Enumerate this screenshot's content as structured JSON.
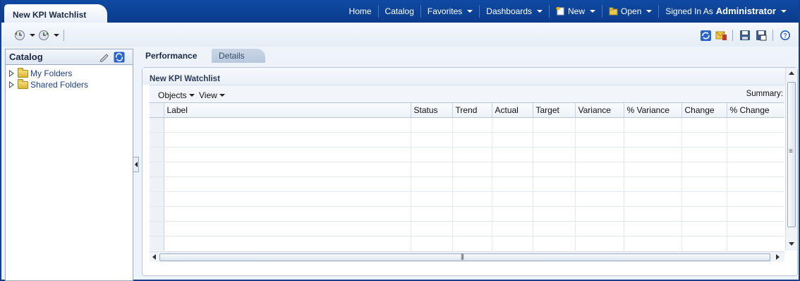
{
  "page_tab": {
    "title": "New KPI Watchlist"
  },
  "global_nav": {
    "home": "Home",
    "catalog": "Catalog",
    "favorites": "Favorites",
    "dashboards": "Dashboards",
    "new": "New",
    "open": "Open",
    "signed_in_as": "Signed In As",
    "user": "Administrator"
  },
  "catalog": {
    "title": "Catalog",
    "items": [
      {
        "label": "My Folders"
      },
      {
        "label": "Shared Folders"
      }
    ]
  },
  "tabs": [
    {
      "label": "Performance",
      "active": true
    },
    {
      "label": "Details",
      "active": false
    }
  ],
  "watchlist": {
    "title": "New KPI Watchlist",
    "menus": {
      "objects": "Objects",
      "view": "View"
    },
    "summary_label": "Summary:",
    "columns": [
      "Label",
      "Status",
      "Trend",
      "Actual",
      "Target",
      "Variance",
      "% Variance",
      "Change",
      "% Change"
    ],
    "empty_row_count": 9
  },
  "colors": {
    "header_bg": "#0a3c8c",
    "accent_blue": "#1d3f8a",
    "panel_bg": "#eef3f9"
  },
  "icons": {
    "toolbar": [
      "history-back-icon",
      "history-forward-icon",
      "refresh-icon",
      "export-icon",
      "save-icon",
      "save-as-icon",
      "help-icon"
    ],
    "catalog": [
      "edit-pencil-icon",
      "refresh-icon"
    ]
  }
}
